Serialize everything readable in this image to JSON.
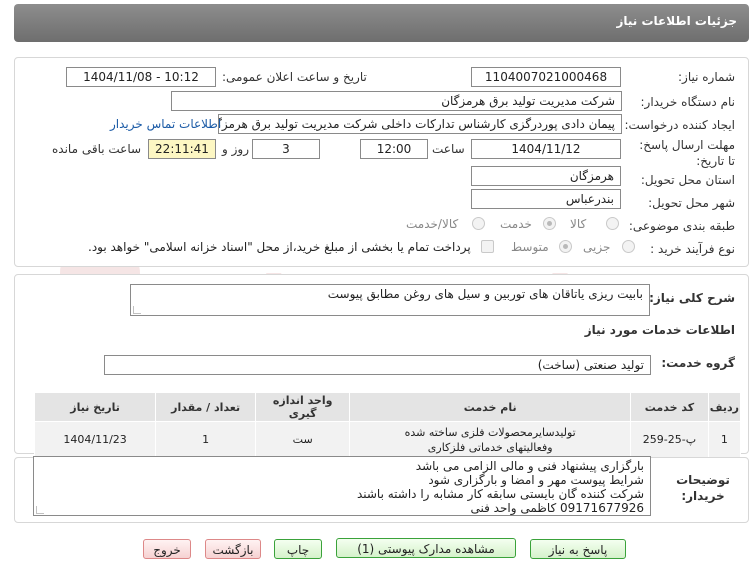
{
  "header": {
    "title": "جزئیات اطلاعات نیاز"
  },
  "watermark": {
    "text": "AriaTender.net"
  },
  "labels": {
    "need_number": "شماره نیاز:",
    "announce_datetime": "تاریخ و ساعت اعلان عمومی:",
    "buyer_org": "نام دستگاه خریدار:",
    "creator": "ایجاد کننده درخواست:",
    "contact_link": "اطلاعات تماس خریدار",
    "deadline": "مهلت ارسال پاسخ: تا تاریخ:",
    "time_word": "ساعت",
    "days_and": "روز و",
    "remaining": "ساعت باقی مانده",
    "province": "استان محل تحویل:",
    "city": "شهر محل تحویل:",
    "category": "طبقه بندی موضوعی:",
    "process_type": "نوع فرآیند خرید :",
    "general_desc": "شرح کلی نیاز:",
    "services_info": "اطلاعات خدمات مورد نیاز",
    "service_group": "گروه خدمت:",
    "buyer_notes": "توضیحات خریدار:"
  },
  "fields": {
    "need_number": "1104007021000468",
    "announce_datetime": "1404/11/08 - 10:12",
    "buyer_org": "شرکت مدیریت تولید برق هرمزگان",
    "creator": "پیمان دادی پوردرگزی کارشناس تدارکات داخلی شرکت مدیریت تولید برق هرمزگان",
    "deadline_date": "1404/11/12",
    "deadline_time": "12:00",
    "days": "3",
    "remaining_time": "22:11:41",
    "province": "هرمزگان",
    "city": "بندرعباس",
    "general_desc": "بابیت ریزی یاتاقان های توربین و سیل های روغن مطابق پیوست",
    "service_group": "تولید صنعتی (ساخت)"
  },
  "category_options": [
    {
      "label": "کالا",
      "selected": false
    },
    {
      "label": "خدمت",
      "selected": true
    },
    {
      "label": "کالا/خدمت",
      "selected": false
    }
  ],
  "process_options": [
    {
      "label": "جزیی",
      "selected": false
    },
    {
      "label": "متوسط",
      "selected": true
    }
  ],
  "payment_note": "پرداخت تمام یا بخشی از مبلغ خرید،از محل \"اسناد خزانه اسلامی\" خواهد بود.",
  "table": {
    "headers": [
      "ردیف",
      "کد خدمت",
      "نام خدمت",
      "واحد اندازه گیری",
      "تعداد / مقدار",
      "تاریخ نیاز"
    ],
    "rows": [
      [
        "1",
        "پ-25-259",
        "تولیدسایرمحصولات فلزی ساخته شده وفعالیتهای خدماتی فلزکاری",
        "ست",
        "1",
        "1404/11/23"
      ]
    ]
  },
  "notes": [
    "بارگزاری پیشنهاد فنی و مالی الزامی می باشد",
    "شرایط پیوست مهر و امضا و بارگزاری شود",
    "شرکت کننده گان بایستی سابقه کار مشابه را داشته باشند",
    "09171677926 کاظمی واحد فنی"
  ],
  "buttons": {
    "reply": "پاسخ به نیاز",
    "attachments": "مشاهده مدارک پیوستی (1)",
    "print": "چاپ",
    "back": "بازگشت",
    "exit": "خروج"
  }
}
